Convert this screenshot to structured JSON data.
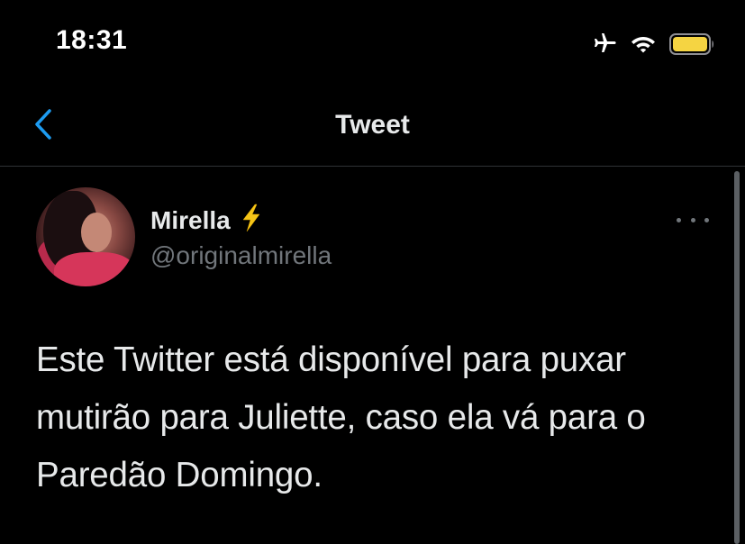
{
  "status_bar": {
    "time": "18:31",
    "icons": [
      "airplane-icon",
      "wifi-icon",
      "battery-icon"
    ],
    "battery_color": "#f5d442"
  },
  "nav": {
    "back_icon": "chevron-left-icon",
    "title": "Tweet",
    "accent_color": "#1d9bf0"
  },
  "tweet": {
    "author": {
      "name": "Mirella",
      "badge": "⚡",
      "handle": "@originalmirella"
    },
    "more_icon": "more-horizontal-icon",
    "text": "Este Twitter está disponível para puxar mutirão para Juliette, caso ela vá para o Paredão Domingo."
  }
}
